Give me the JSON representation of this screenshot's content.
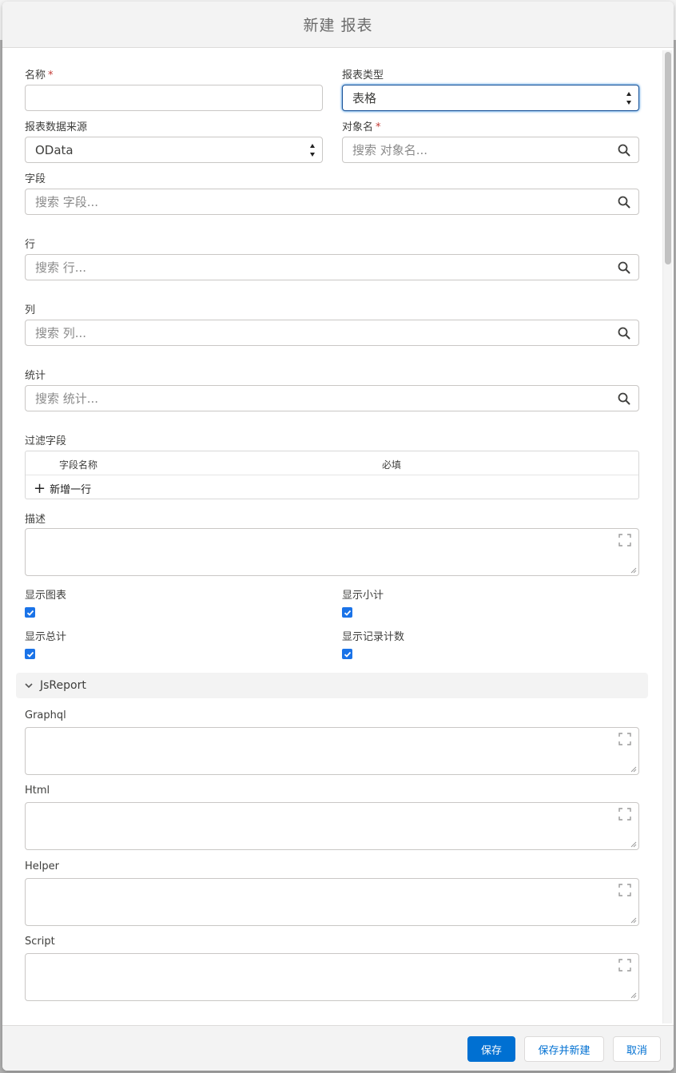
{
  "modal": {
    "title": "新建 报表"
  },
  "fields": {
    "name": {
      "label": "名称",
      "required_mark": "*",
      "value": ""
    },
    "report_type": {
      "label": "报表类型",
      "value": "表格"
    },
    "data_source": {
      "label": "报表数据来源",
      "value": "OData"
    },
    "object_name": {
      "label": "对象名",
      "required_mark": "*",
      "placeholder": "搜索 对象名..."
    },
    "fields_search": {
      "label": "字段",
      "placeholder": "搜索 字段..."
    },
    "rows": {
      "label": "行",
      "placeholder": "搜索 行..."
    },
    "columns": {
      "label": "列",
      "placeholder": "搜索 列..."
    },
    "stats": {
      "label": "统计",
      "placeholder": "搜索 统计..."
    }
  },
  "filter_fields": {
    "label": "过滤字段",
    "col_name": "字段名称",
    "col_required": "必填",
    "add_row": "新增一行"
  },
  "description": {
    "label": "描述"
  },
  "checkboxes": {
    "show_chart": {
      "label": "显示图表",
      "checked": true
    },
    "show_subtotal": {
      "label": "显示小计",
      "checked": true
    },
    "show_total": {
      "label": "显示总计",
      "checked": true
    },
    "show_record_count": {
      "label": "显示记录计数",
      "checked": true
    }
  },
  "jsreport": {
    "section_title": "JsReport",
    "graphql": {
      "label": "Graphql"
    },
    "html": {
      "label": "Html"
    },
    "helper": {
      "label": "Helper"
    },
    "script": {
      "label": "Script"
    }
  },
  "footer": {
    "save": "保存",
    "save_new": "保存并新建",
    "cancel": "取消"
  },
  "colors": {
    "primary": "#0070d2",
    "required": "#c23934",
    "checkbox": "#1a73e8"
  },
  "icons": [
    "search-icon",
    "expand-icon",
    "chevron-down-icon",
    "checkmark-icon",
    "plus-icon",
    "select-arrows-icon"
  ]
}
